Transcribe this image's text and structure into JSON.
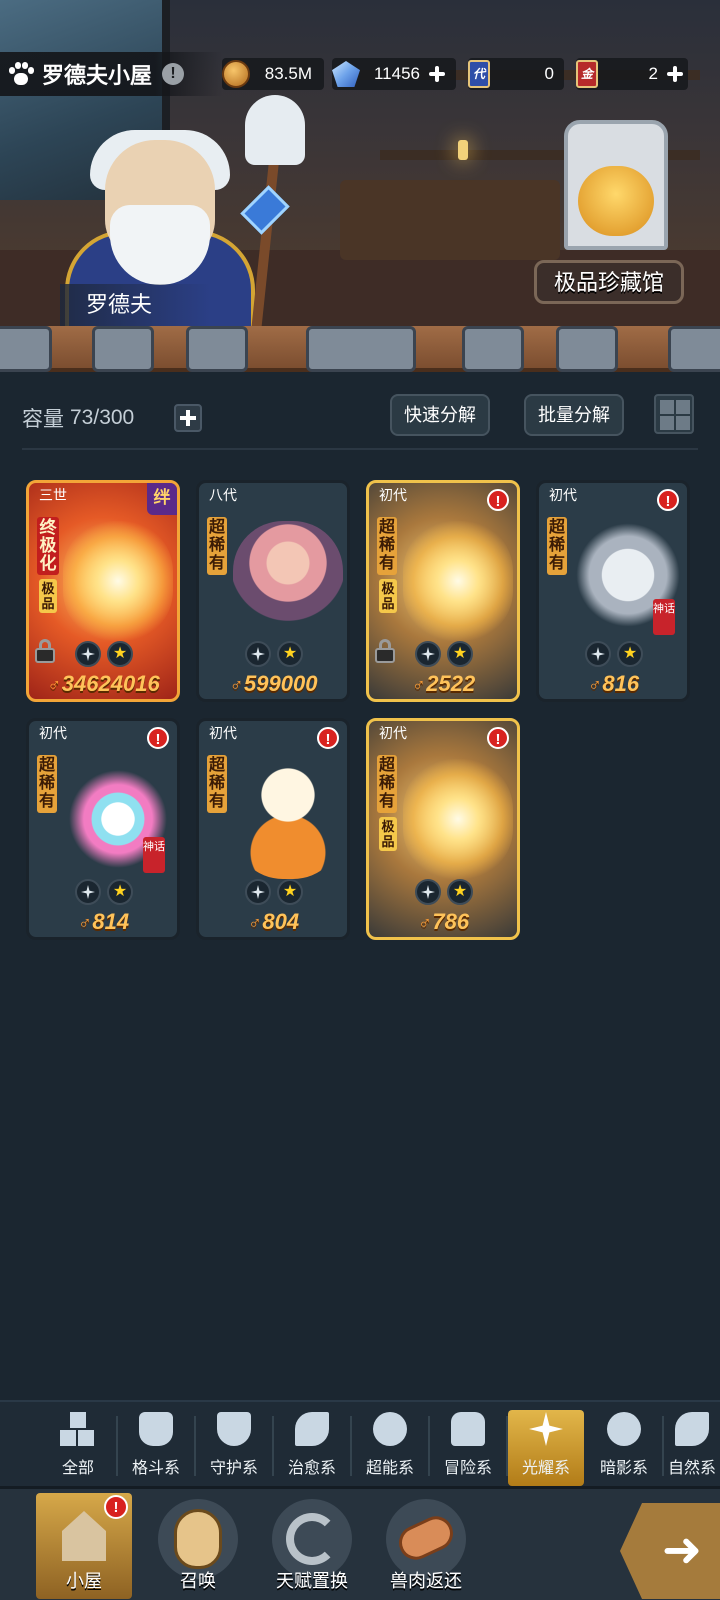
{
  "header": {
    "house_name": "罗德夫小屋",
    "resources": [
      {
        "icon": "coin-icon",
        "value": "83.5M"
      },
      {
        "icon": "diamond-icon",
        "value": "11456"
      },
      {
        "icon": "ticket-icon",
        "badge": "代",
        "value": "0"
      },
      {
        "icon": "gold-card-icon",
        "badge": "金",
        "value": "2"
      }
    ]
  },
  "scene": {
    "keeper_name": "罗德夫",
    "vault_label": "极品珍藏馆"
  },
  "capacity": {
    "label": "容量",
    "value": "73/300"
  },
  "actions": {
    "quick_decompose": "快速分解",
    "batch_decompose": "批量分解"
  },
  "pets": [
    {
      "gen": "三世",
      "badge": "绊",
      "rarity": "终极化",
      "grade": "极品",
      "power": "34624016",
      "locked": true,
      "style": "red"
    },
    {
      "gen": "八代",
      "rarity": "超稀有",
      "power": "599000",
      "style": "plain"
    },
    {
      "gen": "初代",
      "rarity": "超稀有",
      "grade": "极品",
      "power": "2522",
      "locked": true,
      "alert": "!",
      "style": "gold"
    },
    {
      "gen": "初代",
      "rarity": "超稀有",
      "power": "816",
      "alert": "!",
      "myth": "神话",
      "style": "plain"
    },
    {
      "gen": "初代",
      "rarity": "超稀有",
      "power": "814",
      "alert": "!",
      "myth": "神话",
      "style": "plain"
    },
    {
      "gen": "初代",
      "rarity": "超稀有",
      "power": "804",
      "alert": "!",
      "style": "plain"
    },
    {
      "gen": "初代",
      "rarity": "超稀有",
      "grade": "极品",
      "power": "786",
      "alert": "!",
      "style": "gold"
    }
  ],
  "categories": [
    "全部",
    "格斗系",
    "守护系",
    "治愈系",
    "超能系",
    "冒险系",
    "光耀系",
    "暗影系",
    "自然系"
  ],
  "active_category": "光耀系",
  "nav": [
    {
      "label": "小屋",
      "alert": "!"
    },
    {
      "label": "召唤"
    },
    {
      "label": "天赋置换"
    },
    {
      "label": "兽肉返还"
    }
  ],
  "colors": {
    "background": "#1b2630",
    "accent_gold": "#e2b64a",
    "alert_red": "#d8221f",
    "power_orange": "#ffc35a"
  }
}
